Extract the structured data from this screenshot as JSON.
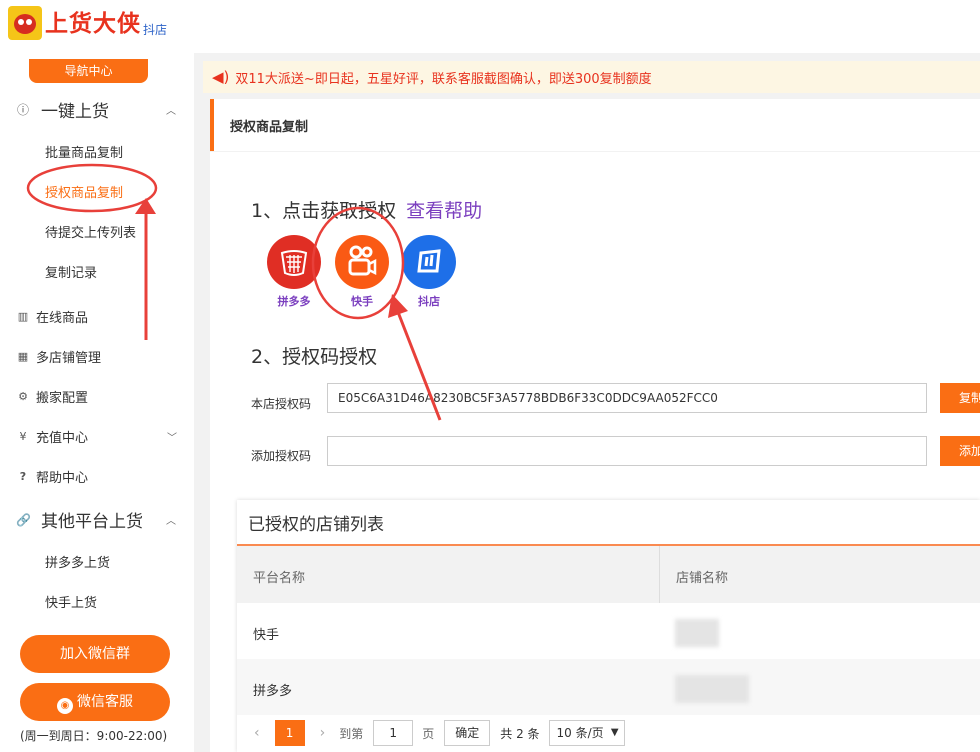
{
  "header": {
    "brand": "上货大侠",
    "brand_sub": "抖店"
  },
  "sidebar": {
    "nav_center": "导航中心",
    "group_one_click": {
      "label": "一键上货",
      "icon": "info-circle-icon"
    },
    "sub_items": [
      "批量商品复制",
      "授权商品复制",
      "待提交上传列表",
      "复制记录"
    ],
    "items": [
      {
        "label": "在线商品",
        "icon": "grid-icon"
      },
      {
        "label": "多店铺管理",
        "icon": "stores-icon"
      },
      {
        "label": "搬家配置",
        "icon": "gear-icon"
      },
      {
        "label": "充值中心",
        "icon": "yen-icon"
      },
      {
        "label": "帮助中心",
        "icon": "question-icon"
      }
    ],
    "group_other": {
      "label": "其他平台上货",
      "icon": "link-icon"
    },
    "other_items": [
      "拼多多上货",
      "快手上货"
    ],
    "btn_wechat_group": "加入微信群",
    "btn_wechat_service": "微信客服",
    "service_hours": "(周一到周日：9:00-22:00)"
  },
  "notice": {
    "text": "双11大派送~即日起，五星好评，联系客服截图确认，即送300复制额度"
  },
  "main": {
    "card_title": "授权商品复制",
    "step1": "1、点击获取授权",
    "help_link": "查看帮助",
    "platforms": [
      {
        "name": "拼多多",
        "color": "#e02e24"
      },
      {
        "name": "快手",
        "color": "#fa5a14"
      },
      {
        "name": "抖店",
        "color": "#1e6fe8"
      }
    ],
    "step2": "2、授权码授权",
    "this_store_label": "本店授权码",
    "this_store_code": "E05C6A31D46A8230BC5F3A5778BDB6F33C0DDC9AA052FCC0",
    "copy_btn": "复制",
    "add_label": "添加授权码",
    "add_placeholder": "",
    "add_btn": "添加"
  },
  "table": {
    "title": "已授权的店铺列表",
    "columns": [
      "平台名称",
      "店铺名称"
    ],
    "rows": [
      {
        "platform": "快手"
      },
      {
        "platform": "拼多多"
      }
    ],
    "pager": {
      "current": "1",
      "goto": "到第",
      "input": "1",
      "page": "页",
      "ok": "确定",
      "total": "共 2 条",
      "size": "10 条/页"
    }
  },
  "colors": {
    "accent": "#fa6e14",
    "annotation": "#e8403a",
    "link": "#7b3fbf"
  }
}
